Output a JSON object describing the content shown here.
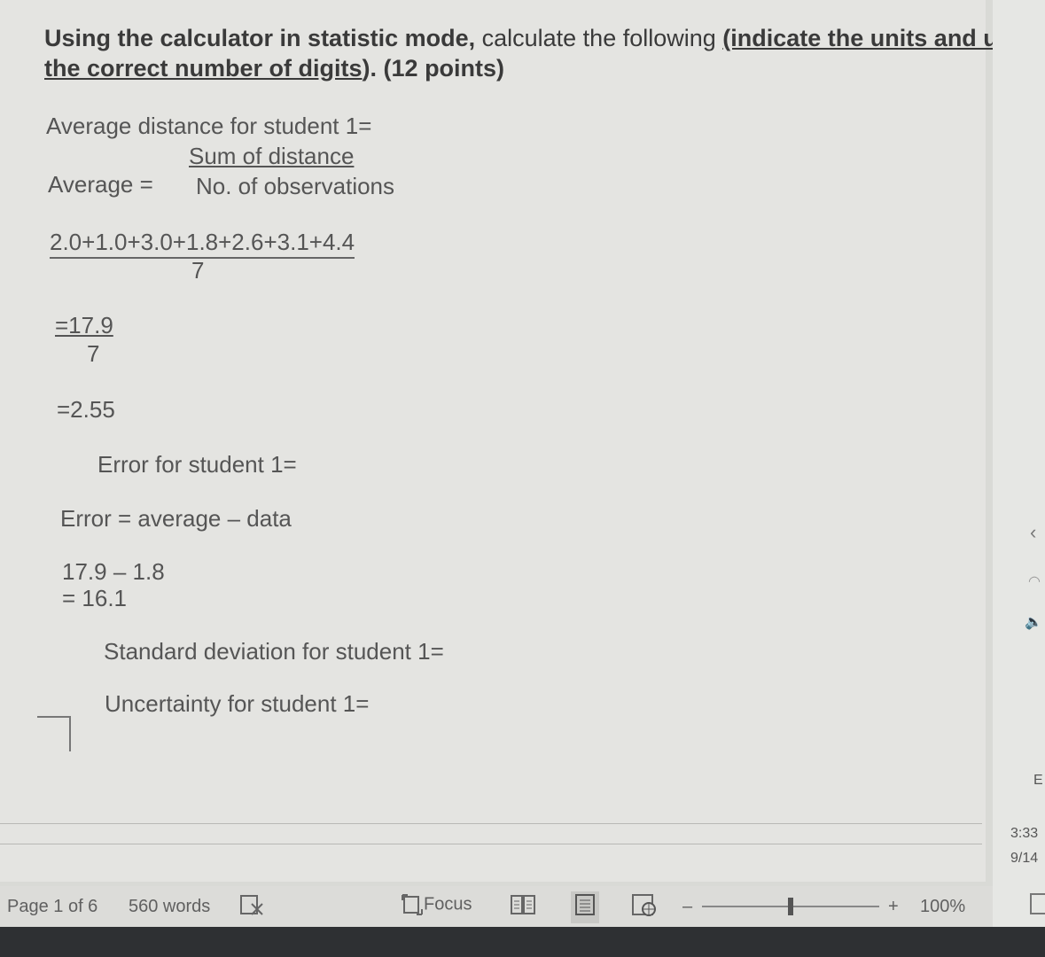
{
  "document": {
    "heading_part1": "Using the calculator in statistic mode,",
    "heading_part2": " calculate the following ",
    "heading_part3": "(indicate the units and use",
    "heading_line2_underlined": "the correct number of digits",
    "heading_line2_rest": "). (12 points)",
    "avg_title": "Average distance for student 1=",
    "avg_numerator": "Sum of distance",
    "avg_label": "Average =",
    "avg_denominator": "No. of observations",
    "sum_expression": "2.0+1.0+3.0+1.8+2.6+3.1+4.4",
    "sum_divisor": "7",
    "result_numerator": "=17.9",
    "result_divisor": "7",
    "result_value": "=2.55",
    "error_title": "Error for student 1=",
    "error_formula": "Error = average – data",
    "error_calc_line1": "17.9 – 1.8",
    "error_calc_line2": "= 16.1",
    "stddev_title": "Standard deviation for student 1=",
    "uncertainty_title": "Uncertainty for student 1="
  },
  "status_bar": {
    "page": "Page 1 of 6",
    "words": "560 words",
    "focus": "Focus",
    "zoom_plus": "+",
    "zoom": "100%",
    "zoom_minus": "–"
  },
  "taskbar": {
    "lang": "E",
    "time": "3:33",
    "date": "9/14"
  }
}
